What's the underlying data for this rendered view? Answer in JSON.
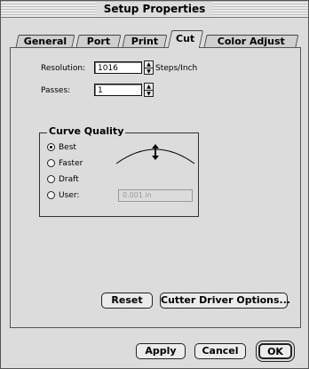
{
  "window": {
    "title": "Setup Properties"
  },
  "tabs": [
    {
      "label": "General",
      "active": false
    },
    {
      "label": "Port",
      "active": false
    },
    {
      "label": "Print",
      "active": false
    },
    {
      "label": "Cut",
      "active": true
    },
    {
      "label": "Color Adjust",
      "active": false
    }
  ],
  "form": {
    "resolution_label": "Resolution:",
    "resolution_value": "1016",
    "resolution_units": "Steps/Inch",
    "passes_label": "Passes:",
    "passes_value": "1"
  },
  "curve_quality": {
    "title": "Curve Quality",
    "options": [
      {
        "label": "Best",
        "checked": true
      },
      {
        "label": "Faster",
        "checked": false
      },
      {
        "label": "Draft",
        "checked": false
      },
      {
        "label": "User:",
        "checked": false
      }
    ],
    "user_value": "0.001 in"
  },
  "buttons": {
    "reset": "Reset",
    "cutter_driver_options": "Cutter Driver Options...",
    "apply": "Apply",
    "cancel": "Cancel",
    "ok": "OK"
  }
}
